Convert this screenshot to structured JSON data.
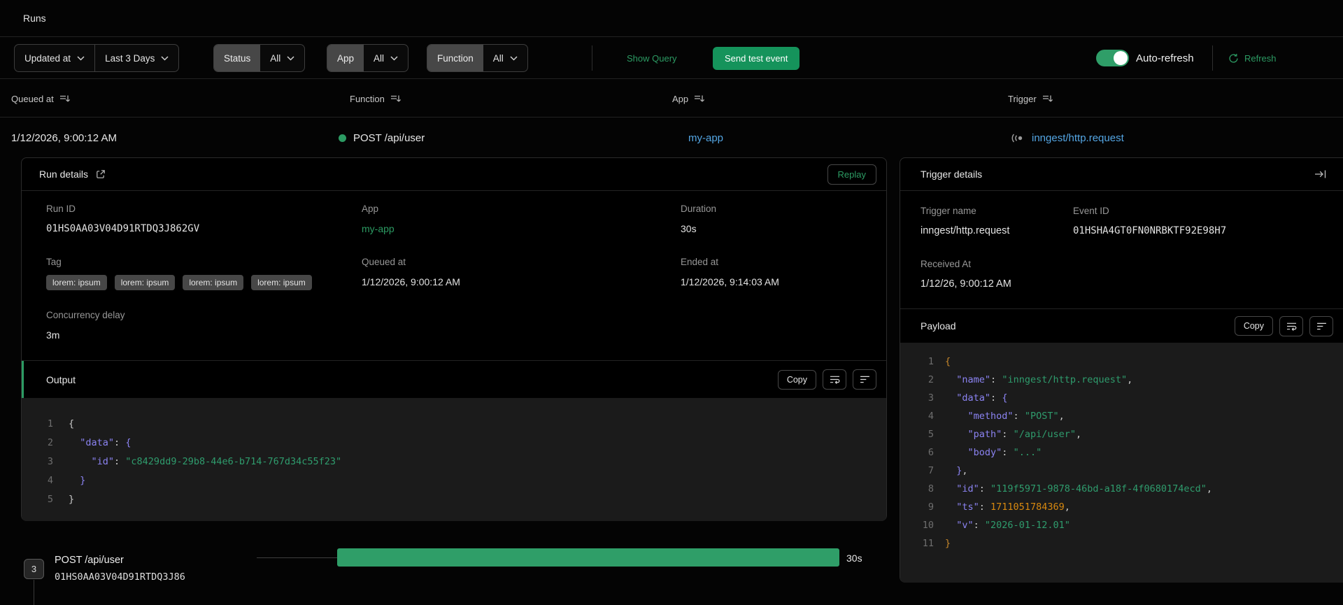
{
  "page": {
    "title": "Runs"
  },
  "filter_bar": {
    "sort_select": {
      "label": "Updated at"
    },
    "range_select": {
      "label": "Last 3 Days"
    },
    "status_filter": {
      "label": "Status",
      "value": "All"
    },
    "app_filter": {
      "label": "App",
      "value": "All"
    },
    "function_filter": {
      "label": "Function",
      "value": "All"
    },
    "show_query_label": "Show Query",
    "send_test_event_label": "Send test event",
    "auto_refresh_label": "Auto-refresh",
    "auto_refresh_on": true,
    "refresh_label": "Refresh"
  },
  "runs_table": {
    "columns": [
      {
        "label": "Queued at"
      },
      {
        "label": "Function"
      },
      {
        "label": "App"
      },
      {
        "label": "Trigger"
      }
    ],
    "row": {
      "queued_at": "1/12/2026, 9:00:12 AM",
      "function_name": "POST /api/user",
      "status_color": "#2c9b63",
      "app": "my-app",
      "trigger": "inngest/http.request"
    }
  },
  "run_details": {
    "title": "Run details",
    "replay_label": "Replay",
    "run_id": {
      "label": "Run ID",
      "value": "01HS0AA03V04D91RTDQ3J862GV"
    },
    "app": {
      "label": "App",
      "value": "my-app"
    },
    "duration": {
      "label": "Duration",
      "value": "30s"
    },
    "tag": {
      "label": "Tag",
      "badges": [
        "lorem: ipsum",
        "lorem: ipsum",
        "lorem: ipsum",
        "lorem: ipsum"
      ]
    },
    "queued_at": {
      "label": "Queued at",
      "value": "1/12/2026, 9:00:12 AM"
    },
    "ended_at": {
      "label": "Ended at",
      "value": "1/12/2026, 9:14:03 AM"
    },
    "concurrency_delay": {
      "label": "Concurrency delay",
      "value": "3m"
    },
    "output": {
      "title": "Output",
      "copy_label": "Copy",
      "lines": [
        [
          {
            "t": "{",
            "c": "br0g"
          }
        ],
        [
          {
            "t": "  "
          },
          {
            "t": "\"data\"",
            "c": "key"
          },
          {
            "t": ": "
          },
          {
            "t": "{",
            "c": "br1"
          }
        ],
        [
          {
            "t": "    "
          },
          {
            "t": "\"id\"",
            "c": "key"
          },
          {
            "t": ": "
          },
          {
            "t": "\"c8429dd9-29b8-44e6-b714-767d34c55f23\"",
            "c": "str"
          }
        ],
        [
          {
            "t": "  "
          },
          {
            "t": "}",
            "c": "br1"
          }
        ],
        [
          {
            "t": "}",
            "c": "br0g"
          }
        ]
      ]
    }
  },
  "trigger_details": {
    "title": "Trigger details",
    "trigger_name": {
      "label": "Trigger name",
      "value": "inngest/http.request"
    },
    "event_id": {
      "label": "Event ID",
      "value": "01HSHA4GT0FN0NRBKTF92E98H7"
    },
    "received_at": {
      "label": "Received At",
      "value": "1/12/26, 9:00:12 AM"
    },
    "payload": {
      "title": "Payload",
      "copy_label": "Copy",
      "lines": [
        [
          {
            "t": "{",
            "c": "br0"
          }
        ],
        [
          {
            "t": "  "
          },
          {
            "t": "\"name\"",
            "c": "key"
          },
          {
            "t": ": "
          },
          {
            "t": "\"inngest/http.request\"",
            "c": "str"
          },
          {
            "t": ","
          }
        ],
        [
          {
            "t": "  "
          },
          {
            "t": "\"data\"",
            "c": "key"
          },
          {
            "t": ": "
          },
          {
            "t": "{",
            "c": "br1"
          }
        ],
        [
          {
            "t": "    "
          },
          {
            "t": "\"method\"",
            "c": "key"
          },
          {
            "t": ": "
          },
          {
            "t": "\"POST\"",
            "c": "str"
          },
          {
            "t": ","
          }
        ],
        [
          {
            "t": "    "
          },
          {
            "t": "\"path\"",
            "c": "key"
          },
          {
            "t": ": "
          },
          {
            "t": "\"/api/user\"",
            "c": "str"
          },
          {
            "t": ","
          }
        ],
        [
          {
            "t": "    "
          },
          {
            "t": "\"body\"",
            "c": "key"
          },
          {
            "t": ": "
          },
          {
            "t": "\"...\"",
            "c": "str"
          }
        ],
        [
          {
            "t": "  "
          },
          {
            "t": "}",
            "c": "br1"
          },
          {
            "t": ","
          }
        ],
        [
          {
            "t": "  "
          },
          {
            "t": "\"id\"",
            "c": "key"
          },
          {
            "t": ": "
          },
          {
            "t": "\"119f5971-9878-46bd-a18f-4f0680174ecd\"",
            "c": "str"
          },
          {
            "t": ","
          }
        ],
        [
          {
            "t": "  "
          },
          {
            "t": "\"ts\"",
            "c": "key"
          },
          {
            "t": ": "
          },
          {
            "t": "1711051784369",
            "c": "num"
          },
          {
            "t": ","
          }
        ],
        [
          {
            "t": "  "
          },
          {
            "t": "\"v\"",
            "c": "key"
          },
          {
            "t": ": "
          },
          {
            "t": "\"2026-01-12.01\"",
            "c": "str"
          }
        ],
        [
          {
            "t": "}",
            "c": "br0"
          }
        ]
      ]
    }
  },
  "timeline": {
    "step_number": "3",
    "function_name": "POST /api/user",
    "run_id": "01HS0AA03V04D91RTDQ3J86",
    "duration": "30s"
  },
  "colors": {
    "accent_green": "#2c9b63",
    "button_green": "#15935b",
    "link_blue": "#54a6e4",
    "code_background": "#1b1b1b",
    "code_key": "#8b83f2",
    "code_string": "#2f9c6d",
    "code_number": "#d7880f",
    "code_brace_outer": "#c8882a"
  }
}
